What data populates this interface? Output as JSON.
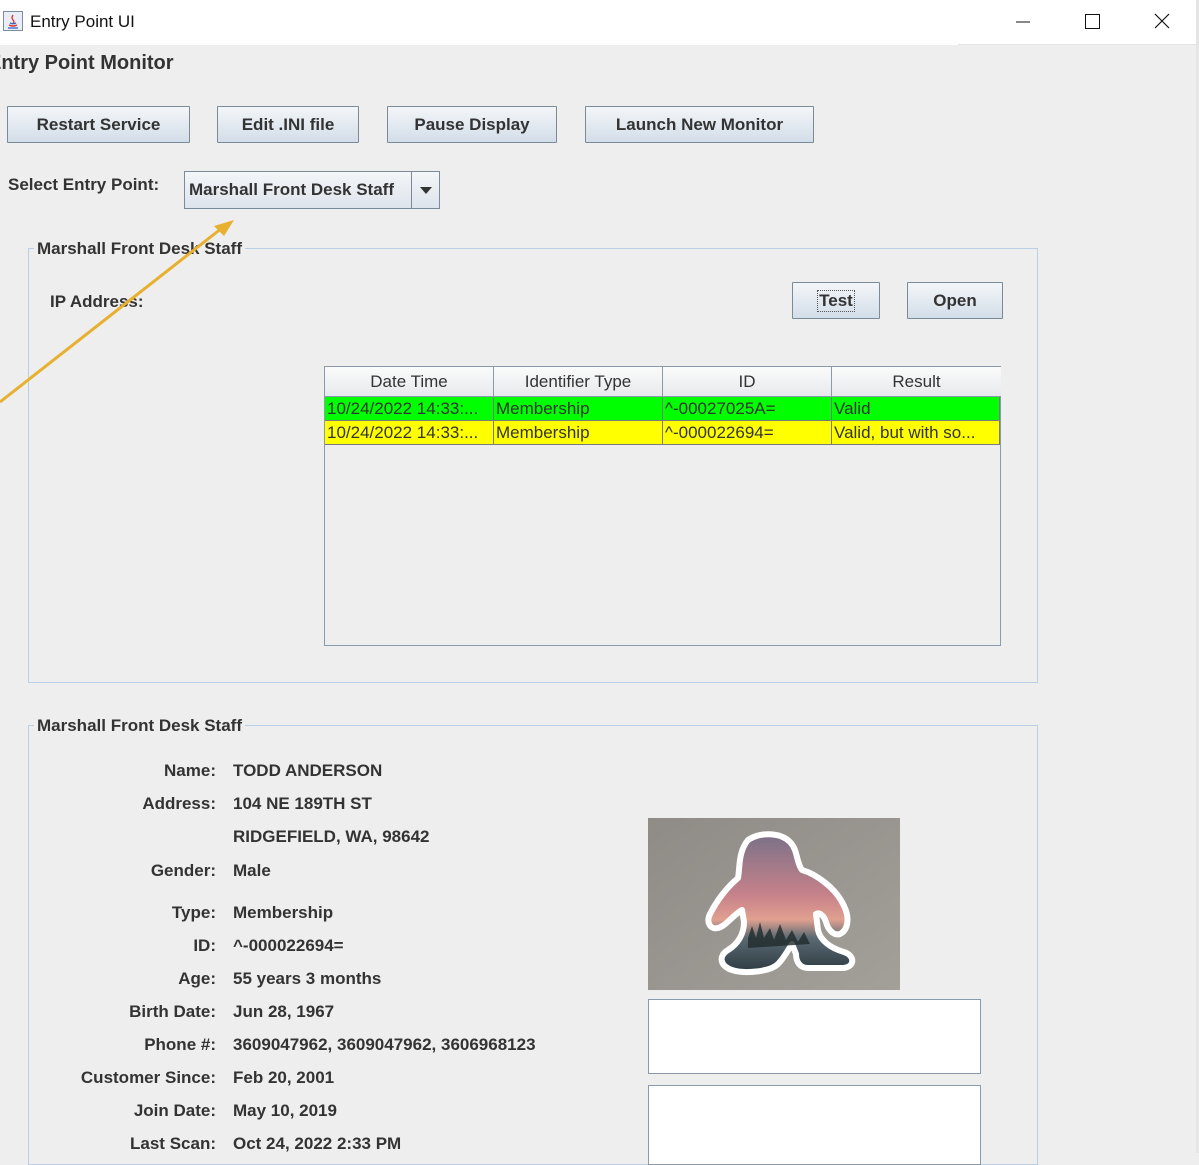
{
  "window": {
    "title": "Entry Point UI",
    "controls": [
      "minimize",
      "maximize",
      "close"
    ]
  },
  "heading": "Entry Point Monitor",
  "toolbar": {
    "restart_label": "Restart Service",
    "edit_ini_label": "Edit .INI file",
    "pause_label": "Pause Display",
    "launch_label": "Launch New Monitor"
  },
  "entry_point": {
    "label": "Select Entry Point:",
    "selected": "Marshall Front Desk Staff"
  },
  "scan_panel": {
    "title": "Marshall Front Desk Staff",
    "ip_label": "IP Address:",
    "test_label": "Test",
    "open_label": "Open",
    "columns": [
      "Date Time",
      "Identifier Type",
      "ID",
      "Result"
    ],
    "rows": [
      {
        "date_time": "10/24/2022 14:33:...",
        "identifier_type": "Membership",
        "id": "^-00027025A=",
        "result": "Valid",
        "color": "#00ff00"
      },
      {
        "date_time": "10/24/2022 14:33:...",
        "identifier_type": "Membership",
        "id": "^-000022694=",
        "result": "Valid, but with so...",
        "color": "#ffff00"
      }
    ]
  },
  "details_panel": {
    "title": "Marshall Front Desk Staff",
    "fields": {
      "name_label": "Name:",
      "name": "TODD ANDERSON",
      "address_label": "Address:",
      "address_line1": "104 NE 189TH ST",
      "address_line2": "RIDGEFIELD, WA, 98642",
      "gender_label": "Gender:",
      "gender": "Male",
      "type_label": "Type:",
      "type": "Membership",
      "id_label": "ID:",
      "id": "^-000022694=",
      "age_label": "Age:",
      "age": "55 years 3 months",
      "birth_label": "Birth Date:",
      "birth_date": "Jun 28, 1967",
      "phone_label": "Phone #:",
      "phone": "3609047962, 3609047962, 3606968123",
      "customer_since_label": "Customer Since:",
      "customer_since": "Feb 20, 2001",
      "join_label": "Join Date:",
      "join_date": "May 10, 2019",
      "last_scan_label": "Last Scan:",
      "last_scan": "Oct 24, 2022 2:33 PM"
    },
    "photo_icon": "bigfoot-silhouette-photo"
  },
  "colors": {
    "valid_row": "#00ff00",
    "warning_row": "#ffff00",
    "annotation_arrow": "#e8b030"
  }
}
